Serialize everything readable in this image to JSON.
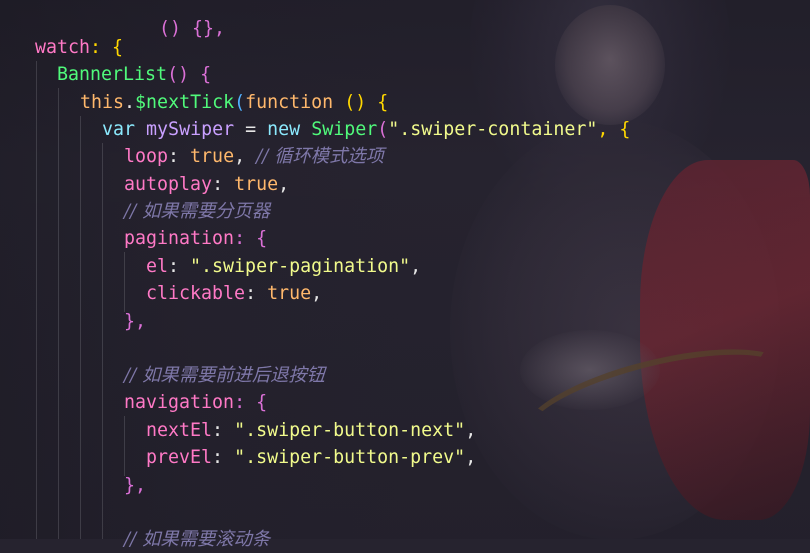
{
  "editor": {
    "lines": {
      "l0": "() {},",
      "l1_key": "watch",
      "l1_rest": ": {",
      "l2_fn": "BannerList",
      "l2_rest": "() {",
      "l3_this": "this",
      "l3_dot": ".",
      "l3_fn": "$nextTick",
      "l3_paren": "(",
      "l3_function": "function",
      "l3_rest": " () {",
      "l4_var": "var",
      "l4_name": "mySwiper",
      "l4_eq": " = ",
      "l4_new": "new",
      "l4_cls": "Swiper",
      "l4_open": "(",
      "l4_str": "\".swiper-container\"",
      "l4_rest": ", {",
      "l5_key": "loop",
      "l5_colon": ": ",
      "l5_val": "true",
      "l5_comma": ", ",
      "l5_cmt": "// 循环模式选项",
      "l6_key": "autoplay",
      "l6_colon": ": ",
      "l6_val": "true",
      "l6_comma": ",",
      "l7_cmt": "// 如果需要分页器",
      "l8_key": "pagination",
      "l8_rest": ": {",
      "l9_key": "el",
      "l9_colon": ": ",
      "l9_str": "\".swiper-pagination\"",
      "l9_comma": ",",
      "l10_key": "clickable",
      "l10_colon": ": ",
      "l10_val": "true",
      "l10_comma": ",",
      "l11": "},",
      "l13_cmt": "// 如果需要前进后退按钮",
      "l14_key": "navigation",
      "l14_rest": ": {",
      "l15_key": "nextEl",
      "l15_colon": ": ",
      "l15_str": "\".swiper-button-next\"",
      "l15_comma": ",",
      "l16_key": "prevEl",
      "l16_colon": ": ",
      "l16_str": "\".swiper-button-prev\"",
      "l16_comma": ",",
      "l17": "},",
      "l19_cmt": "// 如果需要滚动条"
    }
  },
  "colors": {
    "background": "#26232f",
    "keyword": "#ff79c6",
    "function": "#50fa7b",
    "string": "#f1fa8c",
    "boolean": "#ffb86c",
    "comment": "#7e77a8"
  }
}
